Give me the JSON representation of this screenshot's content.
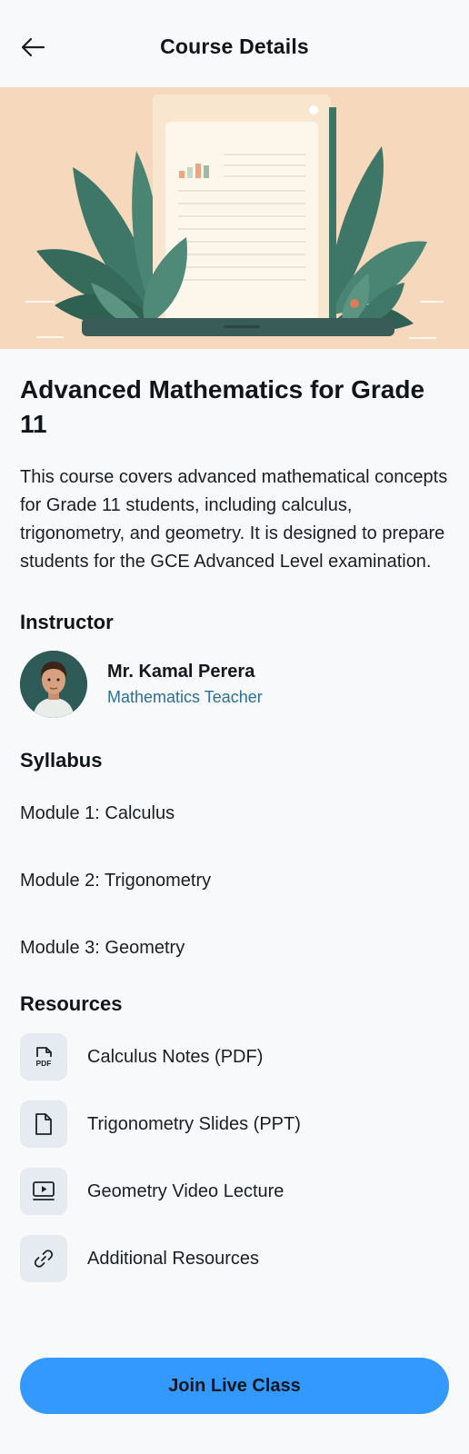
{
  "header": {
    "title": "Course Details",
    "back_icon": "arrow-left-icon"
  },
  "hero": {
    "illustration": "document-with-leaves-illustration",
    "colors": {
      "background": "#f6d8bd",
      "leaf": "#3f7a6a",
      "laptop": "#3a5c58",
      "screen": "#fdf6ea"
    }
  },
  "course": {
    "title": "Advanced Mathematics for Grade 11",
    "description": "This course covers advanced mathematical concepts for Grade 11 students, including calculus, trigonometry, and geometry. It is designed to prepare students for the GCE Advanced Level examination."
  },
  "instructor": {
    "heading": "Instructor",
    "name": "Mr. Kamal Perera",
    "role": "Mathematics Teacher",
    "avatar": "instructor-avatar"
  },
  "syllabus": {
    "heading": "Syllabus",
    "modules": [
      {
        "label": "Module 1: Calculus"
      },
      {
        "label": "Module 2: Trigonometry"
      },
      {
        "label": "Module 3: Geometry"
      }
    ]
  },
  "resources": {
    "heading": "Resources",
    "items": [
      {
        "label": "Calculus Notes (PDF)",
        "icon": "pdf-file-icon"
      },
      {
        "label": "Trigonometry Slides (PPT)",
        "icon": "file-icon"
      },
      {
        "label": "Geometry Video Lecture",
        "icon": "video-icon"
      },
      {
        "label": "Additional Resources",
        "icon": "link-icon"
      }
    ]
  },
  "actions": {
    "join_label": "Join Live Class",
    "accent_color": "#3399ff"
  }
}
